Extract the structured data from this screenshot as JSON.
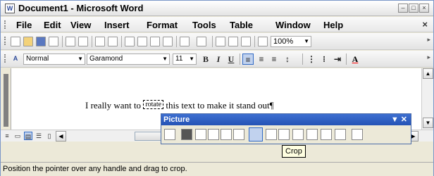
{
  "window": {
    "title": "Document1 - Microsoft Word",
    "app_icon": "W"
  },
  "menu": {
    "items": [
      "File",
      "Edit",
      "View",
      "Insert",
      "Format",
      "Tools",
      "Table",
      "Window",
      "Help"
    ],
    "close_glyph": "×"
  },
  "standard_toolbar": {
    "zoom": "100%"
  },
  "formatting_toolbar": {
    "style": "Normal",
    "font": "Garamond",
    "size": "11",
    "bold": "B",
    "italic": "I",
    "underline": "U"
  },
  "document": {
    "text_before": "I really want to ",
    "selected_word": "rotate",
    "text_after": " this text to make it stand out",
    "pilcrow": "¶"
  },
  "picture_toolbar": {
    "title": "Picture",
    "controls": "▼ ✕",
    "active_tool": "crop"
  },
  "tooltip": {
    "text": "Crop"
  },
  "status": {
    "text": "Position the pointer over any handle and drag to crop."
  }
}
